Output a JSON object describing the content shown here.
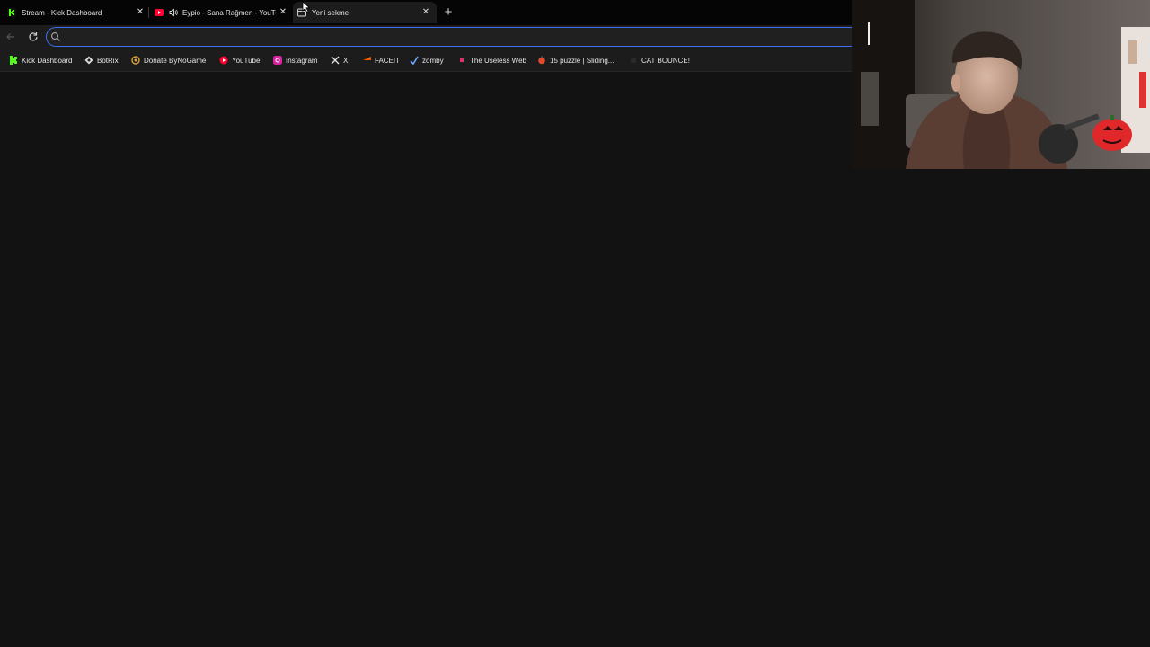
{
  "browser": {
    "tabs": [
      {
        "title": "Stream - Kick Dashboard",
        "icon": "kick-icon",
        "active": false
      },
      {
        "title": "Eypio - Sana Rağmen - YouTu",
        "icon": "youtube-icon",
        "audio": "speaker-icon",
        "active": false
      },
      {
        "title": "Yeni sekme",
        "icon": "newtab-page-icon",
        "active": true
      }
    ],
    "new_tab_icon": "plus-icon",
    "address": {
      "value": "",
      "placeholder": ""
    },
    "bookmarks": [
      {
        "label": "Kick Dashboard",
        "icon": "kick-icon"
      },
      {
        "label": "BotRix",
        "icon": "botrix-icon"
      },
      {
        "label": "Donate ByNoGame",
        "icon": "bynogame-icon"
      },
      {
        "label": "YouTube",
        "icon": "youtube-icon"
      },
      {
        "label": "Instagram",
        "icon": "instagram-icon"
      },
      {
        "label": "X",
        "icon": "x-icon"
      },
      {
        "label": "FACEIT",
        "icon": "faceit-icon"
      },
      {
        "label": "zomby",
        "icon": "zomby-icon"
      },
      {
        "label": "The Useless Web",
        "icon": "useless-web-icon"
      },
      {
        "label": "15 puzzle | Sliding...",
        "icon": "puzzle-icon"
      },
      {
        "label": "CAT BOUNCE!",
        "icon": "cat-bounce-icon"
      }
    ]
  },
  "colors": {
    "accent": "#3d6ff0",
    "background": "#121212",
    "toolbar": "#1c1c1c",
    "kick_green": "#53fc18",
    "youtube_red": "#ff0033"
  }
}
